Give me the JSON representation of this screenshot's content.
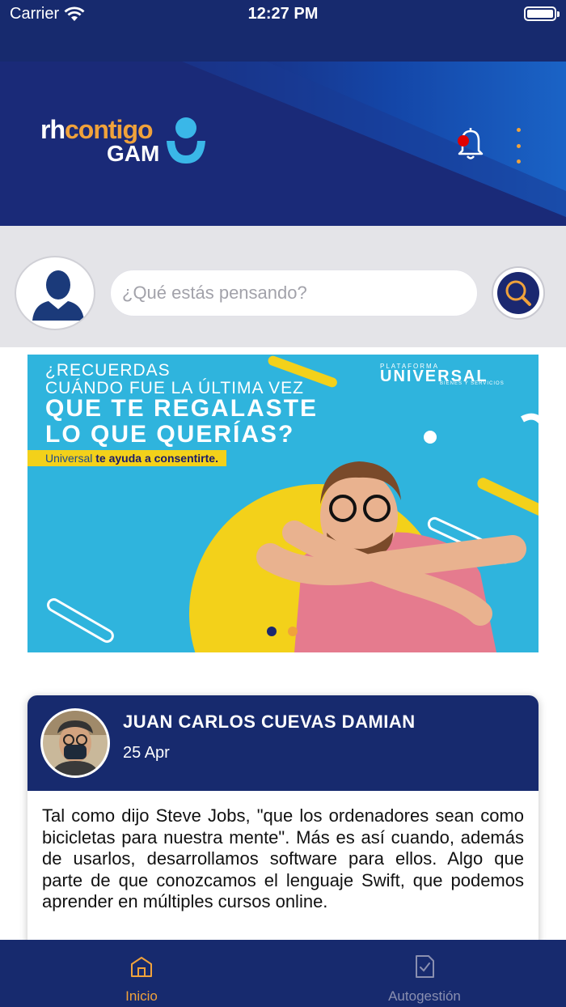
{
  "status_bar": {
    "carrier": "Carrier",
    "time": "12:27 PM"
  },
  "header": {
    "logo_text_white": "rh",
    "logo_text_orange": "contigo",
    "logo_subtext": "GAM",
    "notification_icon": "bell-icon",
    "menu_icon": "kebab-menu-icon"
  },
  "composer": {
    "placeholder": "¿Qué estás pensando?",
    "avatar_icon": "user-silhouette-icon",
    "search_icon": "magnifier-icon"
  },
  "banner": {
    "line1": "¿RECUERDAS",
    "line2": "CUÁNDO FUE LA ÚLTIMA VEZ",
    "line3": "QUE TE REGALASTE",
    "line4": "LO QUE QUERÍAS?",
    "tag_prefix": "Universal",
    "tag_bold": "te ayuda a consentirte.",
    "brand_small": "PLATAFORMA",
    "brand": "UNIVERSAL",
    "brand_sub": "BIENES Y SERVICIOS",
    "carousel_count": 2,
    "carousel_active_index": 0,
    "colors": {
      "background": "#2fb4dd",
      "accent": "#f3d11a",
      "dot_active": "#1b2870",
      "dot_inactive": "#f0a23b"
    }
  },
  "post": {
    "author": "JUAN CARLOS CUEVAS DAMIAN",
    "date": "25 Apr",
    "body": "Tal como dijo Steve Jobs, \"que los ordenadores sean como bicicletas para nuestra mente\". Más es así cuando, además de usarlos, desarrollamos software para ellos. Algo que parte de que conozcamos el lenguaje Swift, que podemos aprender en múltiples cursos online."
  },
  "tabs": [
    {
      "label": "Inicio",
      "icon": "home-icon",
      "active": true
    },
    {
      "label": "Autogestión",
      "icon": "document-check-icon",
      "active": false
    }
  ],
  "colors": {
    "navy": "#172a6e",
    "accent_orange": "#f0a23b",
    "inactive_tab": "#8a8fb0",
    "notification_dot": "#e00000"
  }
}
